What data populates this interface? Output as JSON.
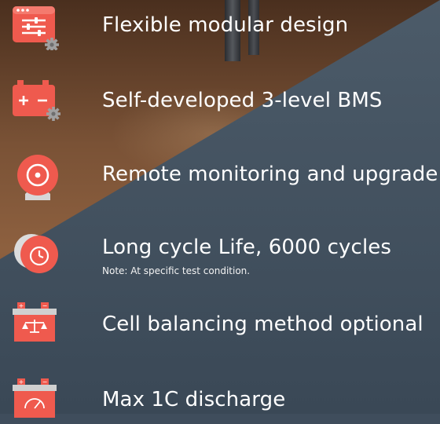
{
  "features": [
    {
      "label": "Flexible modular design",
      "icon": "settings-panel-icon"
    },
    {
      "label": "Self-developed 3-level BMS",
      "icon": "battery-gear-icon"
    },
    {
      "label": "Remote monitoring and upgrade",
      "icon": "camera-icon"
    },
    {
      "label": "Long cycle Life, 6000 cycles",
      "note": "Note: At specific test condition.",
      "icon": "clock-icon"
    },
    {
      "label": "Cell balancing method optional",
      "icon": "battery-balance-icon"
    },
    {
      "label": "Max 1C discharge",
      "icon": "battery-gauge-icon"
    }
  ],
  "colors": {
    "accent": "#ef5a4e",
    "gear": "#9a9a9a",
    "text": "#ffffff"
  }
}
